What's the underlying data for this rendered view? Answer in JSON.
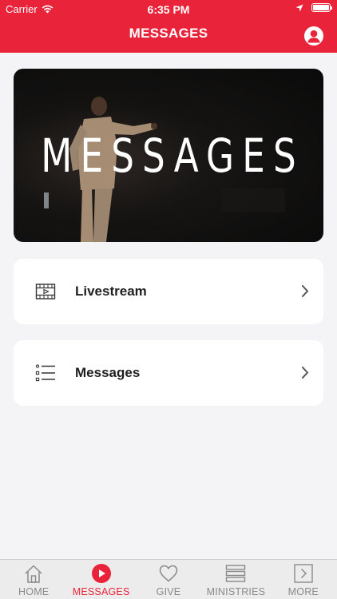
{
  "status_bar": {
    "carrier": "Carrier",
    "time": "6:35 PM"
  },
  "header": {
    "title": "MESSAGES",
    "profile_icon": "profile-icon"
  },
  "hero": {
    "title": "MESSAGES"
  },
  "menu": [
    {
      "label": "Livestream",
      "icon": "video-icon"
    },
    {
      "label": "Messages",
      "icon": "list-icon"
    }
  ],
  "tabbar": {
    "items": [
      {
        "label": "HOME",
        "icon": "home-icon",
        "active": false
      },
      {
        "label": "MESSAGES",
        "icon": "play-icon",
        "active": true
      },
      {
        "label": "GIVE",
        "icon": "heart-icon",
        "active": false
      },
      {
        "label": "MINISTRIES",
        "icon": "bars-icon",
        "active": false
      },
      {
        "label": "MORE",
        "icon": "more-icon",
        "active": false
      }
    ]
  },
  "colors": {
    "brand": "#e8233a",
    "tab_inactive": "#8a8a8a",
    "background": "#f4f4f7"
  }
}
